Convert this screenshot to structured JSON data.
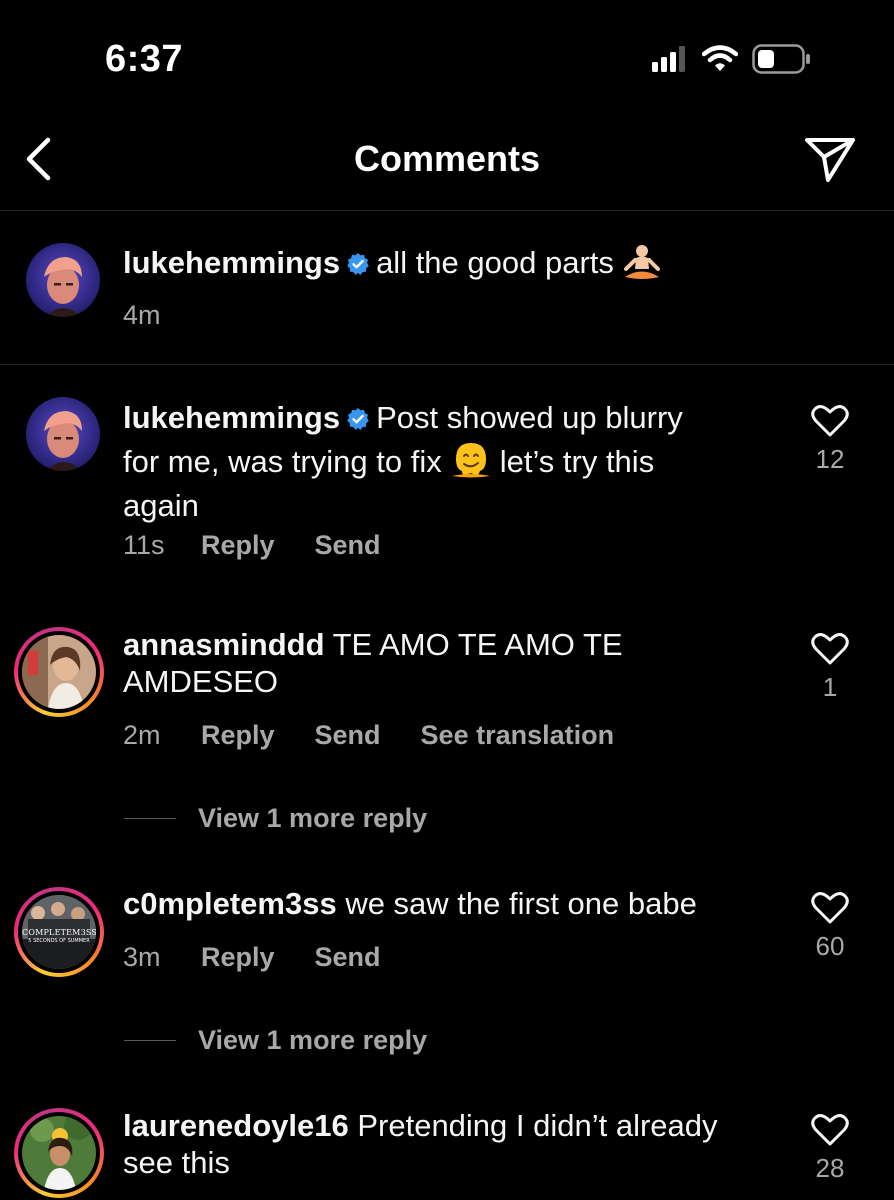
{
  "status_bar": {
    "time": "6:37"
  },
  "header": {
    "title": "Comments"
  },
  "caption": {
    "username": "lukehemmings",
    "text": "all the good parts",
    "time": "4m"
  },
  "comments": [
    {
      "username": "lukehemmings",
      "text_line1": "Post showed up blurry",
      "text_line2a": "for me, was trying to fix",
      "text_line2b": "let’s try this",
      "text_line3": "again",
      "time": "11s",
      "reply": "Reply",
      "send": "Send",
      "likes": "12"
    },
    {
      "username": "annasminddd",
      "text_line1": "TE AMO TE AMO TE",
      "text_line2": "AMDESEO",
      "time": "2m",
      "reply": "Reply",
      "send": "Send",
      "see_translation": "See translation",
      "likes": "1",
      "view_more": "View 1 more reply"
    },
    {
      "username": "c0mpletem3ss",
      "text": "we saw the first one babe",
      "time": "3m",
      "reply": "Reply",
      "send": "Send",
      "likes": "60",
      "view_more": "View 1 more reply",
      "avatar_text_1": "COMPLETEM3SS",
      "avatar_text_2": "5 SECONDS OF SUMMER"
    },
    {
      "username": "laurenedoyle16",
      "text_line1": "Pretending I didn’t already",
      "text_line2": "see this",
      "likes": "28"
    }
  ],
  "icons": {
    "back": "chevron-left-icon",
    "share": "paper-plane-icon",
    "verified": "verified-badge-icon",
    "like": "heart-outline-icon"
  },
  "colors": {
    "background": "#000000",
    "text": "#f5f5f5",
    "secondary": "#a8a8a8",
    "verified": "#3797f0",
    "divider": "#262626"
  }
}
